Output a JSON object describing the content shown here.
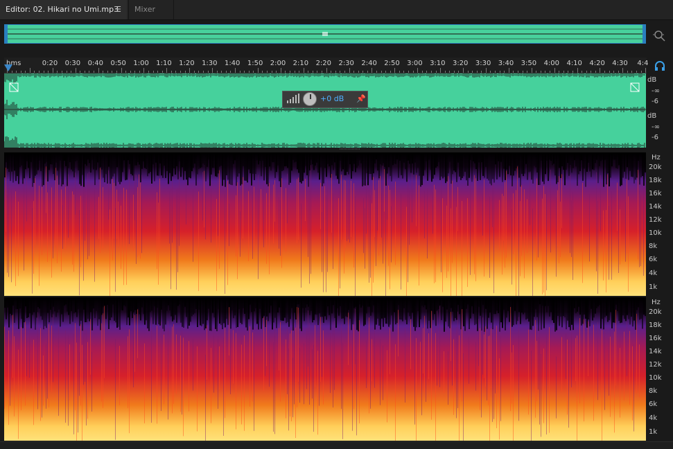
{
  "tabs": {
    "editor_label": "Editor: 02. Hikari no Umi.mp3",
    "editor_menu_icon": "hamburger-menu-icon",
    "mixer_label": "Mixer"
  },
  "overview": {
    "zoom_icon": "zoom-magnifier-icon"
  },
  "ruler": {
    "unit_label": "hms",
    "ticks": [
      "0:20",
      "0:30",
      "0:40",
      "0:50",
      "1:00",
      "1:10",
      "1:20",
      "1:30",
      "1:40",
      "1:50",
      "2:00",
      "2:10",
      "2:20",
      "2:30",
      "2:40",
      "2:50",
      "3:00",
      "3:10",
      "3:20",
      "3:30",
      "3:40",
      "3:50",
      "4:00",
      "4:10",
      "4:20",
      "4:30",
      "4:4"
    ],
    "monitor_icon": "headphone-monitor-icon"
  },
  "waveform": {
    "color": "#46d19c",
    "channel1_db": [
      "dB",
      "-∞",
      "-6"
    ],
    "channel2_db": [
      "dB",
      "-∞",
      "-6"
    ]
  },
  "hud": {
    "level_icon": "volume-level-icon",
    "knob_icon": "gain-knob-icon",
    "value": "+0 dB",
    "pin_icon": "pin-icon"
  },
  "spectrogram": {
    "channel1_hz": [
      "Hz",
      "20k",
      "18k",
      "16k",
      "14k",
      "12k",
      "10k",
      "8k",
      "6k",
      "4k",
      "1k"
    ],
    "channel2_hz": [
      "Hz",
      "20k",
      "18k",
      "16k",
      "14k",
      "12k",
      "10k",
      "8k",
      "6k",
      "4k",
      "1k"
    ],
    "colors": {
      "low": "#000000",
      "mid_low": "#5a1f8c",
      "mid": "#cc1a2b",
      "mid_high": "#f07a1c",
      "high": "#ffe27a"
    }
  }
}
